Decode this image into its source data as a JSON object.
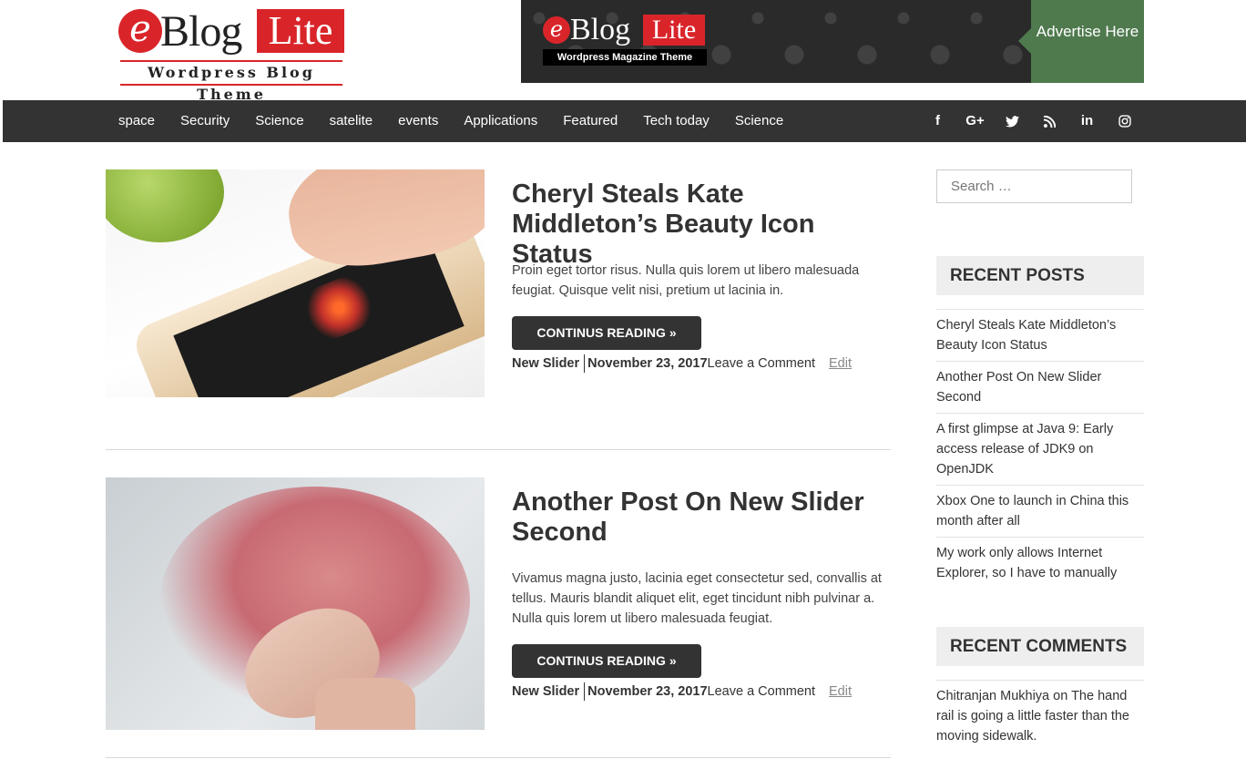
{
  "header": {
    "logo": {
      "e": "e",
      "blog": "Blog",
      "lite": "Lite",
      "tagline": "Wordpress Blog Theme"
    },
    "ad": {
      "e": "e",
      "blog": "Blog",
      "lite": "Lite",
      "tagline": "Wordpress Magazine Theme",
      "cta": "Advertise Here"
    }
  },
  "nav": {
    "items": [
      "space",
      "Security",
      "Science",
      "satelite",
      "events",
      "Applications",
      "Featured",
      "Tech today",
      "Science"
    ],
    "social": [
      "facebook-icon",
      "google-plus-icon",
      "twitter-icon",
      "rss-icon",
      "linkedin-icon",
      "instagram-icon"
    ],
    "social_glyphs": [
      "f",
      "G+",
      "🐦",
      "◉",
      "in",
      "◎"
    ]
  },
  "posts": [
    {
      "title": "Cheryl Steals Kate Middleton’s Beauty Icon Status",
      "excerpt": "Proin eget tortor risus. Nulla quis lorem ut libero malesuada feugiat. Quisque velit nisi, pretium ut lacinia in.",
      "button": "CONTINUS READING »",
      "category": "New Slider",
      "date": "November 23, 2017",
      "comment": "Leave a Comment",
      "edit": "Edit"
    },
    {
      "title": "Another Post On New Slider Second",
      "excerpt": "Vivamus magna justo, lacinia eget consectetur sed, convallis at tellus. Mauris blandit aliquet elit, eget tincidunt nibh pulvinar a. Nulla quis lorem ut libero malesuada feugiat.",
      "button": "CONTINUS READING »",
      "category": "New Slider",
      "date": "November 23, 2017",
      "comment": "Leave a Comment",
      "edit": "Edit"
    }
  ],
  "sidebar": {
    "search_placeholder": "Search …",
    "recent_posts_title": "RECENT POSTS",
    "recent_posts": [
      "Cheryl Steals Kate Middleton’s Beauty Icon Status",
      "Another Post On New Slider Second",
      "A first glimpse at Java 9: Early access release of JDK9 on OpenJDK",
      "Xbox One to launch in China this month after all",
      "My work only allows Internet Explorer, so I have to manually"
    ],
    "recent_comments_title": "RECENT COMMENTS",
    "recent_comments": [
      {
        "author": "Chitranjan Mukhiya",
        "on": " on ",
        "post": "The hand rail is going a little faster than the moving sidewalk."
      }
    ]
  },
  "colors": {
    "brand_red": "#d9252a",
    "nav_bg": "#333333",
    "ad_green": "#4f7a4e",
    "widget_bg": "#eeeeee"
  }
}
